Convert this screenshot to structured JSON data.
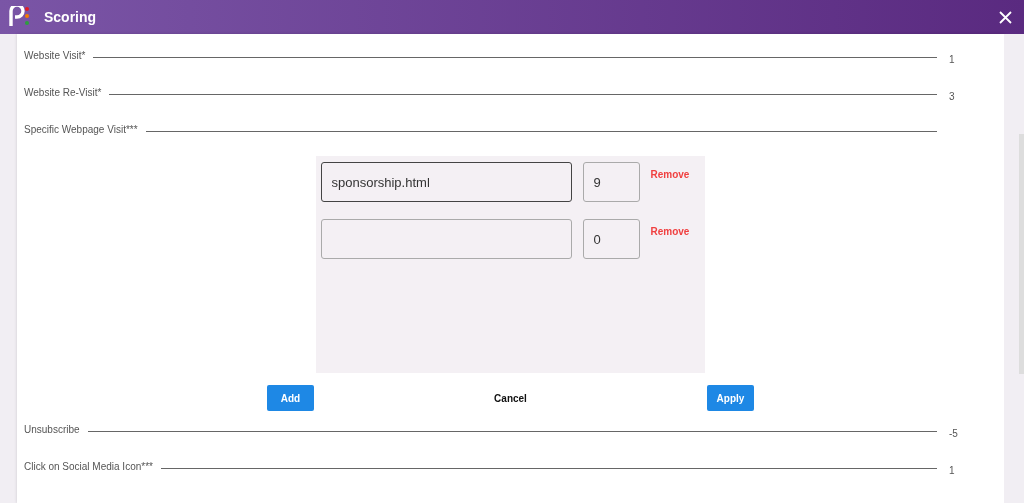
{
  "window": {
    "title": "Scoring"
  },
  "rules_top": [
    {
      "label": "Website Visit*",
      "value": "1"
    },
    {
      "label": "Website Re-Visit*",
      "value": "3"
    },
    {
      "label": "Specific Webpage Visit***"
    }
  ],
  "pages": [
    {
      "url": "sponsorship.html",
      "score": "9",
      "focused": true,
      "remove": "Remove"
    },
    {
      "score": "0",
      "focused": false,
      "remove": "Remove"
    }
  ],
  "buttons": {
    "add": "Add",
    "cancel": "Cancel",
    "apply": "Apply"
  },
  "rules_bottom": [
    {
      "label": "Unsubscribe",
      "value": "-5"
    },
    {
      "label": "Click on Social Media Icon***",
      "value": "1"
    }
  ]
}
